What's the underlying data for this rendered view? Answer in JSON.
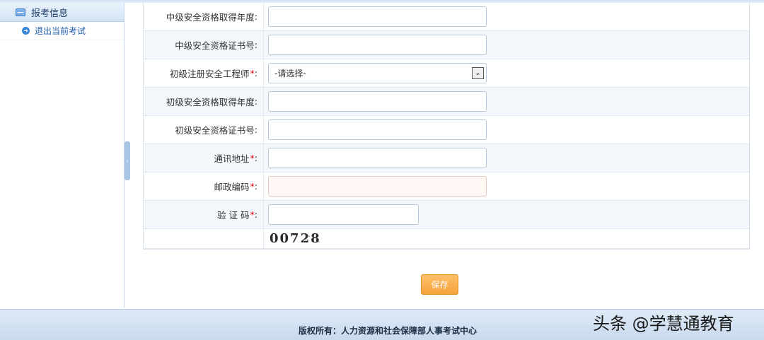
{
  "sidebar": {
    "header_label": "报考信息",
    "items": [
      {
        "label": "退出当前考试"
      }
    ]
  },
  "form": {
    "rows": [
      {
        "label": "中级安全资格取得年度",
        "suffix": ":",
        "required": false,
        "type": "text",
        "value": ""
      },
      {
        "label": "中级安全资格证书号",
        "suffix": ":",
        "required": false,
        "type": "text",
        "value": ""
      },
      {
        "label": "初级注册安全工程师",
        "suffix": ":",
        "required": true,
        "type": "select",
        "value": "-请选择-"
      },
      {
        "label": "初级安全资格取得年度",
        "suffix": ":",
        "required": false,
        "type": "text",
        "value": ""
      },
      {
        "label": "初级安全资格证书号",
        "suffix": ":",
        "required": false,
        "type": "text",
        "value": ""
      },
      {
        "label": "通讯地址",
        "suffix": ":",
        "required": true,
        "type": "text",
        "value": ""
      },
      {
        "label": "邮政编码",
        "suffix": ":",
        "required": true,
        "type": "text",
        "value": ""
      },
      {
        "label": "验 证 码",
        "suffix": ":",
        "required": true,
        "type": "text",
        "value": ""
      }
    ],
    "required_mark": "*",
    "captcha_text": "00728"
  },
  "save_label": "保存",
  "footer": {
    "copyright": "版权所有：人力资源和社会保障部人事考试中心"
  },
  "watermark": "头条 @学慧通教育",
  "colors": {
    "accent": "#1e5aa8",
    "button": "#f5a23a",
    "required": "#dd0000"
  },
  "icons": {
    "sidebar_header": "list-icon",
    "sidebar_item": "arrow-circle-icon",
    "select": "chevron-down-icon",
    "splitter": "collapse-handle-icon"
  }
}
